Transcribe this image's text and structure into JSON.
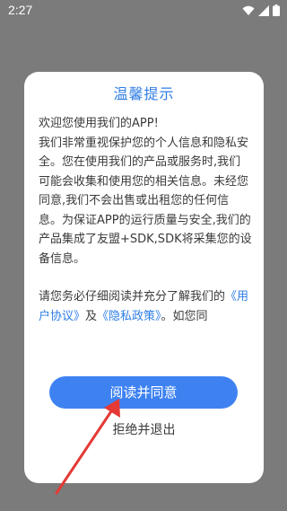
{
  "status_bar": {
    "time": "2:27",
    "icons": [
      "wifi-icon",
      "signal-icon",
      "battery-icon"
    ]
  },
  "dialog": {
    "title": "温馨提示",
    "body": {
      "line1": "欢迎您使用我们的APP!",
      "line2": "我们非常重视保护您的个人信息和隐私安全。您在使用我们的产品或服务时,我们可能会收集和使用您的相关信息。未经您同意,我们不会出售或出租您的任何信息。为保证APP的运行质量与安全,我们的产品集成了友盟+SDK,SDK将采集您的设备信息。",
      "line3_prefix": "请您务必仔细阅读并充分了解我们的",
      "user_agreement": "《用户协议》",
      "and": "及",
      "privacy_policy": "《隐私政策》",
      "suffix": "。如您同"
    },
    "agree_button": "阅读并同意",
    "reject_button": "拒绝并退出"
  },
  "colors": {
    "accent": "#3e82f2",
    "title": "#2f7ee6",
    "overlay": "#7b7b7b",
    "annotation_arrow": "#e53935"
  }
}
